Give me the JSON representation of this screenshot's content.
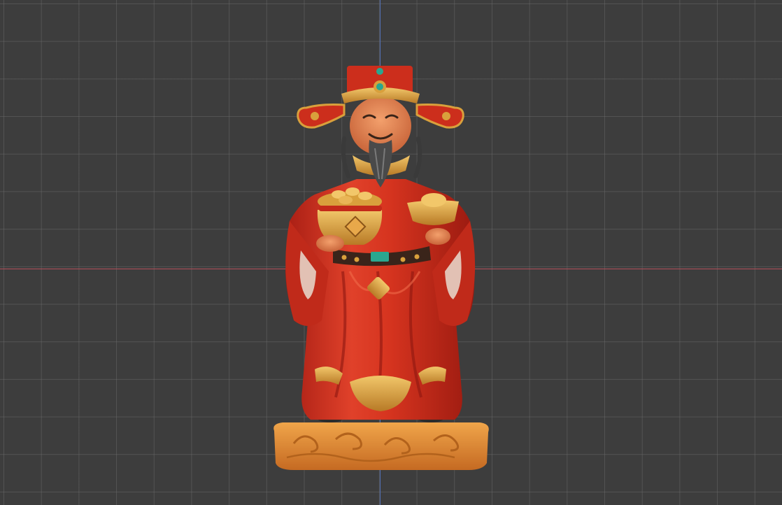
{
  "viewport": {
    "background_color": "#3d3d3d",
    "grid_color": "#6e6e6e",
    "axis_x_color": "#b4505a",
    "axis_y_color": "#5270b4"
  },
  "model": {
    "icon": "caishen-statue-3d-model",
    "colors": {
      "robe": "#d0301e",
      "gold": "#d9a03c",
      "base": "#e08a32",
      "beard": "#3a3a3a",
      "jade": "#2aa78f"
    }
  }
}
